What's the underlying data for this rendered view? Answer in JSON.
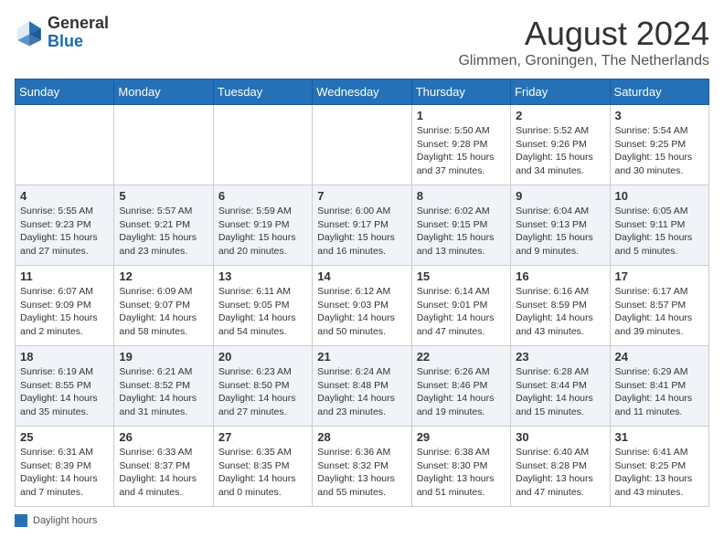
{
  "header": {
    "logo_general": "General",
    "logo_blue": "Blue",
    "month_year": "August 2024",
    "location": "Glimmen, Groningen, The Netherlands"
  },
  "days_of_week": [
    "Sunday",
    "Monday",
    "Tuesday",
    "Wednesday",
    "Thursday",
    "Friday",
    "Saturday"
  ],
  "footer": {
    "daylight_label": "Daylight hours"
  },
  "weeks": [
    [
      {
        "day": "",
        "info": ""
      },
      {
        "day": "",
        "info": ""
      },
      {
        "day": "",
        "info": ""
      },
      {
        "day": "",
        "info": ""
      },
      {
        "day": "1",
        "info": "Sunrise: 5:50 AM\nSunset: 9:28 PM\nDaylight: 15 hours\nand 37 minutes."
      },
      {
        "day": "2",
        "info": "Sunrise: 5:52 AM\nSunset: 9:26 PM\nDaylight: 15 hours\nand 34 minutes."
      },
      {
        "day": "3",
        "info": "Sunrise: 5:54 AM\nSunset: 9:25 PM\nDaylight: 15 hours\nand 30 minutes."
      }
    ],
    [
      {
        "day": "4",
        "info": "Sunrise: 5:55 AM\nSunset: 9:23 PM\nDaylight: 15 hours\nand 27 minutes."
      },
      {
        "day": "5",
        "info": "Sunrise: 5:57 AM\nSunset: 9:21 PM\nDaylight: 15 hours\nand 23 minutes."
      },
      {
        "day": "6",
        "info": "Sunrise: 5:59 AM\nSunset: 9:19 PM\nDaylight: 15 hours\nand 20 minutes."
      },
      {
        "day": "7",
        "info": "Sunrise: 6:00 AM\nSunset: 9:17 PM\nDaylight: 15 hours\nand 16 minutes."
      },
      {
        "day": "8",
        "info": "Sunrise: 6:02 AM\nSunset: 9:15 PM\nDaylight: 15 hours\nand 13 minutes."
      },
      {
        "day": "9",
        "info": "Sunrise: 6:04 AM\nSunset: 9:13 PM\nDaylight: 15 hours\nand 9 minutes."
      },
      {
        "day": "10",
        "info": "Sunrise: 6:05 AM\nSunset: 9:11 PM\nDaylight: 15 hours\nand 5 minutes."
      }
    ],
    [
      {
        "day": "11",
        "info": "Sunrise: 6:07 AM\nSunset: 9:09 PM\nDaylight: 15 hours\nand 2 minutes."
      },
      {
        "day": "12",
        "info": "Sunrise: 6:09 AM\nSunset: 9:07 PM\nDaylight: 14 hours\nand 58 minutes."
      },
      {
        "day": "13",
        "info": "Sunrise: 6:11 AM\nSunset: 9:05 PM\nDaylight: 14 hours\nand 54 minutes."
      },
      {
        "day": "14",
        "info": "Sunrise: 6:12 AM\nSunset: 9:03 PM\nDaylight: 14 hours\nand 50 minutes."
      },
      {
        "day": "15",
        "info": "Sunrise: 6:14 AM\nSunset: 9:01 PM\nDaylight: 14 hours\nand 47 minutes."
      },
      {
        "day": "16",
        "info": "Sunrise: 6:16 AM\nSunset: 8:59 PM\nDaylight: 14 hours\nand 43 minutes."
      },
      {
        "day": "17",
        "info": "Sunrise: 6:17 AM\nSunset: 8:57 PM\nDaylight: 14 hours\nand 39 minutes."
      }
    ],
    [
      {
        "day": "18",
        "info": "Sunrise: 6:19 AM\nSunset: 8:55 PM\nDaylight: 14 hours\nand 35 minutes."
      },
      {
        "day": "19",
        "info": "Sunrise: 6:21 AM\nSunset: 8:52 PM\nDaylight: 14 hours\nand 31 minutes."
      },
      {
        "day": "20",
        "info": "Sunrise: 6:23 AM\nSunset: 8:50 PM\nDaylight: 14 hours\nand 27 minutes."
      },
      {
        "day": "21",
        "info": "Sunrise: 6:24 AM\nSunset: 8:48 PM\nDaylight: 14 hours\nand 23 minutes."
      },
      {
        "day": "22",
        "info": "Sunrise: 6:26 AM\nSunset: 8:46 PM\nDaylight: 14 hours\nand 19 minutes."
      },
      {
        "day": "23",
        "info": "Sunrise: 6:28 AM\nSunset: 8:44 PM\nDaylight: 14 hours\nand 15 minutes."
      },
      {
        "day": "24",
        "info": "Sunrise: 6:29 AM\nSunset: 8:41 PM\nDaylight: 14 hours\nand 11 minutes."
      }
    ],
    [
      {
        "day": "25",
        "info": "Sunrise: 6:31 AM\nSunset: 8:39 PM\nDaylight: 14 hours\nand 7 minutes."
      },
      {
        "day": "26",
        "info": "Sunrise: 6:33 AM\nSunset: 8:37 PM\nDaylight: 14 hours\nand 4 minutes."
      },
      {
        "day": "27",
        "info": "Sunrise: 6:35 AM\nSunset: 8:35 PM\nDaylight: 14 hours\nand 0 minutes."
      },
      {
        "day": "28",
        "info": "Sunrise: 6:36 AM\nSunset: 8:32 PM\nDaylight: 13 hours\nand 55 minutes."
      },
      {
        "day": "29",
        "info": "Sunrise: 6:38 AM\nSunset: 8:30 PM\nDaylight: 13 hours\nand 51 minutes."
      },
      {
        "day": "30",
        "info": "Sunrise: 6:40 AM\nSunset: 8:28 PM\nDaylight: 13 hours\nand 47 minutes."
      },
      {
        "day": "31",
        "info": "Sunrise: 6:41 AM\nSunset: 8:25 PM\nDaylight: 13 hours\nand 43 minutes."
      }
    ]
  ]
}
